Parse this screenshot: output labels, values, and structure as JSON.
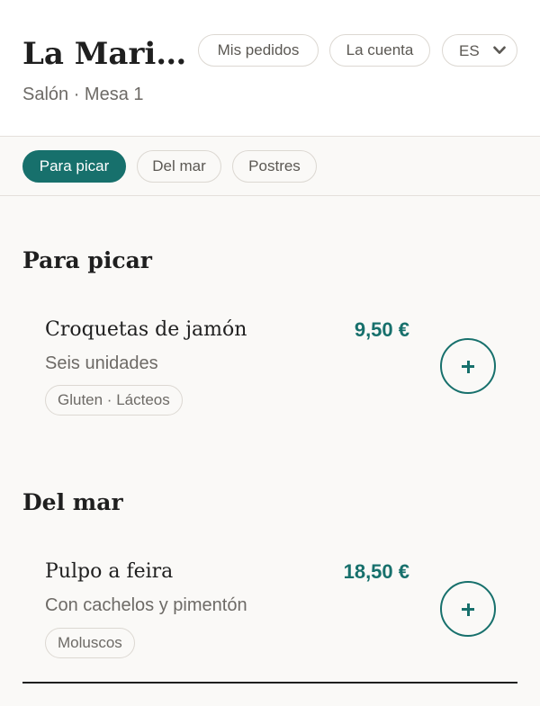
{
  "header": {
    "title": "La Mari…",
    "subtitle": "Salón · Mesa 1",
    "orders_label": "Mis pedidos",
    "bill_label": "La cuenta",
    "language": "ES"
  },
  "tabs": [
    {
      "label": "Para picar",
      "active": true
    },
    {
      "label": "Del mar",
      "active": false
    },
    {
      "label": "Postres",
      "active": false
    }
  ],
  "sections": [
    {
      "title": "Para picar",
      "items": [
        {
          "name": "Croquetas de jamón",
          "price": "9,50 €",
          "description": "Seis unidades",
          "allergens": "Gluten · Lácteos"
        }
      ]
    },
    {
      "title": "Del mar",
      "items": [
        {
          "name": "Pulpo a feira",
          "price": "18,50 €",
          "description": "Con cachelos y pimentón",
          "allergens": "Moluscos"
        }
      ]
    }
  ],
  "icons": {
    "language_dropdown": "chevron-down-icon",
    "add_item": "plus-icon"
  },
  "colors": {
    "accent": "#17706c",
    "text": "#1f1f1f",
    "muted": "#6d6a66",
    "background": "#faf9f7"
  }
}
